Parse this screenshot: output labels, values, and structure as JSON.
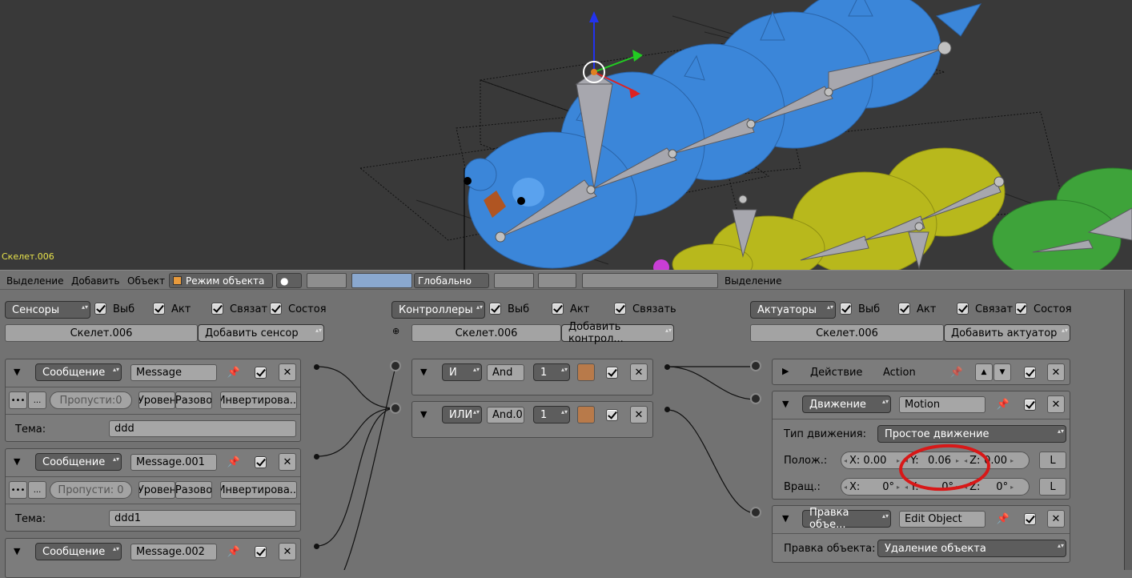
{
  "viewport": {
    "object_name": "Скелет.006"
  },
  "header": {
    "menus": [
      "Выделение",
      "Добавить",
      "Объект"
    ],
    "mode": "Режим объекта",
    "orientation": "Глобально",
    "right_menu": "Выделение"
  },
  "sensors": {
    "type": "Сенсоры",
    "checks": [
      "Выб",
      "Акт",
      "Связат",
      "Состоя"
    ],
    "object": "Скелет.006",
    "add": "Добавить сенсор",
    "items": [
      {
        "type": "Сообщение",
        "name": "Message",
        "skip": "Пропусти:0",
        "level": "Уровен",
        "tap": "Разово",
        "invert": "Инвертирова...",
        "subject_label": "Тема:",
        "subject": "ddd"
      },
      {
        "type": "Сообщение",
        "name": "Message.001",
        "skip": "Пропусти: 0",
        "level": "Уровен",
        "tap": "Разово",
        "invert": "Инвертирова...",
        "subject_label": "Тема:",
        "subject": "ddd1"
      },
      {
        "type": "Сообщение",
        "name": "Message.002"
      }
    ]
  },
  "controllers": {
    "type": "Контроллеры",
    "checks": [
      "Выб",
      "Акт",
      "Связать"
    ],
    "object": "Скелет.006",
    "add": "Добавить контрол...",
    "items": [
      {
        "type": "И",
        "name": "And",
        "state": "1"
      },
      {
        "type": "ИЛИ",
        "name": "And.0",
        "state": "1"
      }
    ]
  },
  "actuators": {
    "type": "Актуаторы",
    "checks": [
      "Выб",
      "Акт",
      "Связат",
      "Состоя"
    ],
    "object": "Скелет.006",
    "add": "Добавить актуатор",
    "action": {
      "label": "Действие",
      "name": "Action"
    },
    "motion": {
      "type": "Движение",
      "name": "Motion",
      "motion_type_label": "Тип движения:",
      "motion_type": "Простое движение",
      "loc_label": "Полож.:",
      "loc": {
        "x": "X: 0.00",
        "y": "Y:",
        "y_val": "0.06",
        "z": "Z:",
        "z_val": "0.00"
      },
      "rot_label": "Вращ.:",
      "rot": {
        "x": "X:",
        "x_val": "0°",
        "y": "Y:",
        "y_val": "0°",
        "z": "Z:",
        "z_val": "0°"
      },
      "local": "L"
    },
    "edit": {
      "type": "Правка объе...",
      "name": "Edit Object",
      "label": "Правка объекта:",
      "value": "Удаление объекта"
    }
  }
}
